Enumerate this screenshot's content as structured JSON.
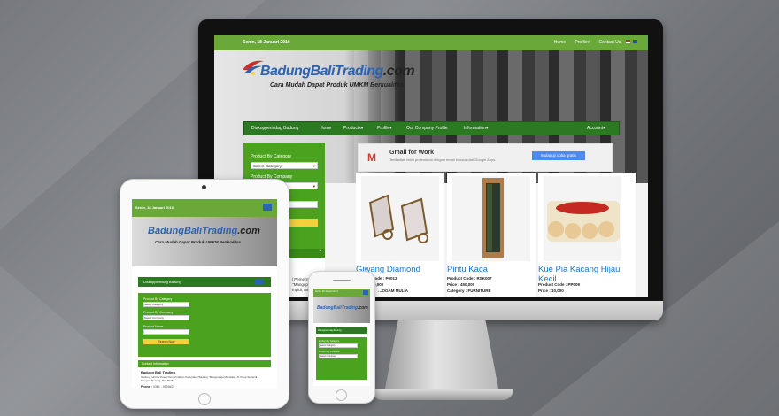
{
  "site": {
    "date": "Senin, 18 Januari 2016",
    "top_nav": [
      "Home",
      "Profile▾",
      "Contact Us"
    ],
    "logo_text_blue": "BadungBaliTrading",
    "logo_text_dark": ".com",
    "tagline": "Cara Mudah Dapat Produk UMKM Berkualitas",
    "brand": "Diskopperindag Badung",
    "main_nav": [
      "Home",
      "Products▾",
      "Profile▾",
      "Our Company Profile",
      "Information▾",
      "Account▾"
    ],
    "sidebar": {
      "category_label": "Product By Category",
      "category_select": "Select Category",
      "company_label": "Product By Company",
      "company_select": "Select Company",
      "name_label": "Product Name",
      "search_button": "Search Now"
    },
    "ad": {
      "title": "Gmail for Work",
      "subtitle": "Terlihatlah lebih profesional dengan email khusus dari Google Apps.",
      "button": "Mulai uji coba gratis"
    },
    "products": [
      {
        "name": "Giwang Diamond",
        "code": "Product Code : P0013",
        "price": "Price : 250,000",
        "extra": "…OGAM MULIA"
      },
      {
        "name": "Pintu Kaca",
        "code": "Product Code : RSK007",
        "price": "Price : 450,000",
        "extra": "Category : FURNITURE"
      },
      {
        "name": "Kue Pia Kacang Hijau Kecil",
        "code": "Product Code : PP009",
        "price": "Price : 10,000",
        "extra": ""
      }
    ],
    "contact": {
      "title": "Contact Information",
      "company": "Badung Bali Trading",
      "address": "Gedung, Unit IV Pusat Pemerintahan Kabupaten Badung \"Mangupraja Mandala\", Jl. Raya Sempidi, Mengwi, Badung, Bali 80351",
      "phone_label": "Phone :",
      "phone": "0361 - 9009421"
    },
    "partial_text": [
      "l Pemerintahan",
      "\"Mangupraja",
      "mpidi, Mengwi"
    ],
    "cookie_pill": "ntine"
  },
  "colors": {
    "green": "#6aa83a",
    "dark_green": "#2b7a21",
    "side_green": "#4aa21f",
    "link_blue": "#1c74c8",
    "button_yellow": "#f4d03f"
  }
}
